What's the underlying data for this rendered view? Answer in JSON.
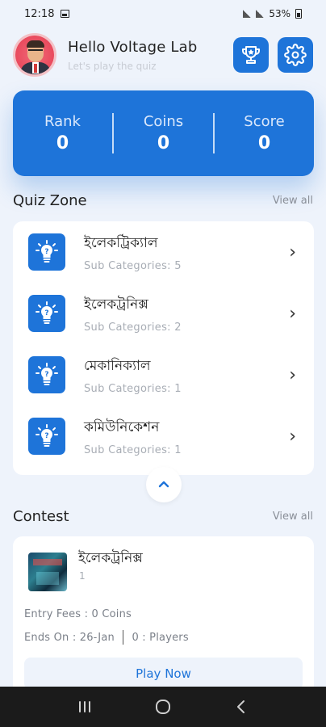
{
  "status_bar": {
    "time": "12:18",
    "battery": "53%"
  },
  "header": {
    "greeting": "Hello Voltage Lab",
    "subtitle": "Let's play the quiz"
  },
  "stats": [
    {
      "label": "Rank",
      "value": "0"
    },
    {
      "label": "Coins",
      "value": "0"
    },
    {
      "label": "Score",
      "value": "0"
    }
  ],
  "quiz_zone": {
    "title": "Quiz Zone",
    "view_all": "View all",
    "items": [
      {
        "title": "ইলেকট্রিক্যাল",
        "sub": "Sub Categories: 5"
      },
      {
        "title": "ইলেকট্রনিক্স",
        "sub": "Sub Categories: 2"
      },
      {
        "title": "মেকানিক্যাল",
        "sub": "Sub Categories: 1"
      },
      {
        "title": "কমিউনিকেশন",
        "sub": "Sub Categories: 1"
      }
    ]
  },
  "contest": {
    "title": "Contest",
    "view_all": "View all",
    "card": {
      "name": "ইলেকট্রনিক্স",
      "count": "1",
      "entry_label": "Entry Fees",
      "entry_value": "0 Coins",
      "ends_label": "Ends On",
      "ends_value": "26-Jan",
      "players_count": "0",
      "players_label": "Players",
      "play_button": "Play Now"
    }
  },
  "colors": {
    "accent": "#1e74d9",
    "background": "#eef3fb"
  },
  "icons": {
    "trophy": "trophy-icon",
    "settings": "gear-icon",
    "category": "bulb-icon",
    "chevron": "chevron-right-icon",
    "collapse": "chevron-up-icon"
  }
}
